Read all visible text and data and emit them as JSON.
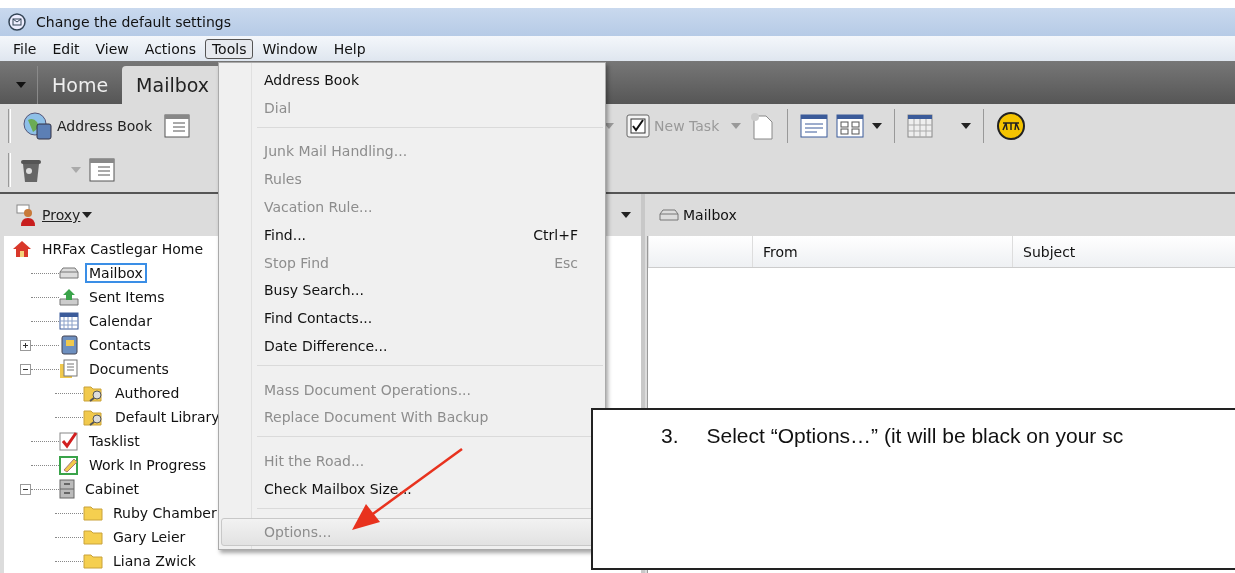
{
  "window": {
    "title": "Change the default settings"
  },
  "menubar": [
    {
      "label": "File",
      "selected": false
    },
    {
      "label": "Edit",
      "selected": false
    },
    {
      "label": "View",
      "selected": false
    },
    {
      "label": "Actions",
      "selected": false
    },
    {
      "label": "Tools",
      "selected": true
    },
    {
      "label": "Window",
      "selected": false
    },
    {
      "label": "Help",
      "selected": false
    }
  ],
  "tabs": [
    {
      "label": "Home",
      "selected": false
    },
    {
      "label": "Mailbox",
      "selected": true
    }
  ],
  "toolbar": {
    "address_book": "Address Book",
    "new_task": {
      "label": "New Task",
      "disabled": true
    }
  },
  "left_pane": {
    "proxy": "Proxy",
    "tree": {
      "label": "HRFax Castlegar Home",
      "kind": "home",
      "children": [
        {
          "label": "Mailbox",
          "kind": "mailbox",
          "selected": true
        },
        {
          "label": "Sent Items",
          "kind": "sent",
          "selected": false
        },
        {
          "label": "Calendar",
          "kind": "calendar",
          "selected": false
        },
        {
          "label": "Contacts",
          "kind": "contacts",
          "selected": false,
          "expanded": false
        },
        {
          "label": "Documents",
          "kind": "documents",
          "selected": false,
          "expanded": true,
          "children": [
            {
              "label": "Authored",
              "kind": "library",
              "selected": false
            },
            {
              "label": "Default Library",
              "kind": "library",
              "selected": false
            }
          ]
        },
        {
          "label": "Tasklist",
          "kind": "tasklist",
          "selected": false
        },
        {
          "label": "Work In Progress",
          "kind": "work",
          "selected": false
        },
        {
          "label": "Cabinet",
          "kind": "cabinet",
          "selected": false,
          "expanded": true,
          "children": [
            {
              "label": "Ruby Chamber",
              "kind": "folder",
              "selected": false
            },
            {
              "label": "Gary Leier",
              "kind": "folder",
              "selected": false
            },
            {
              "label": "Liana Zwick",
              "kind": "folder",
              "selected": false
            }
          ]
        }
      ]
    }
  },
  "right_pane": {
    "title": "Mailbox",
    "columns": [
      "From",
      "Subject"
    ]
  },
  "tools_menu": [
    {
      "kind": "item",
      "label": "Address Book",
      "disabled": false,
      "selected": false
    },
    {
      "kind": "item",
      "label": "Dial",
      "disabled": true,
      "selected": false
    },
    {
      "kind": "separator"
    },
    {
      "kind": "item",
      "label": "Junk Mail Handling...",
      "disabled": true,
      "selected": false
    },
    {
      "kind": "item",
      "label": "Rules",
      "disabled": true,
      "selected": false
    },
    {
      "kind": "item",
      "label": "Vacation Rule...",
      "disabled": true,
      "selected": false
    },
    {
      "kind": "item",
      "label": "Find...",
      "shortcut": "Ctrl+F",
      "disabled": false,
      "selected": false
    },
    {
      "kind": "item",
      "label": "Stop Find",
      "shortcut": "Esc",
      "disabled": true,
      "selected": false
    },
    {
      "kind": "item",
      "label": "Busy Search...",
      "disabled": false,
      "selected": false
    },
    {
      "kind": "item",
      "label": "Find Contacts...",
      "disabled": false,
      "selected": false
    },
    {
      "kind": "item",
      "label": "Date Difference...",
      "disabled": false,
      "selected": false
    },
    {
      "kind": "separator"
    },
    {
      "kind": "item",
      "label": "Mass Document Operations...",
      "disabled": true,
      "selected": false
    },
    {
      "kind": "item",
      "label": "Replace Document With Backup",
      "disabled": true,
      "selected": false
    },
    {
      "kind": "separator"
    },
    {
      "kind": "item",
      "label": "Hit the Road...",
      "disabled": true,
      "selected": false
    },
    {
      "kind": "item",
      "label": "Check Mailbox Size...",
      "disabled": false,
      "selected": false
    },
    {
      "kind": "separator"
    },
    {
      "kind": "item",
      "label": "Options...",
      "disabled": true,
      "selected": true
    }
  ],
  "callout": {
    "number": "3.",
    "text": "Select “Options…” (it will be black on your sc"
  }
}
